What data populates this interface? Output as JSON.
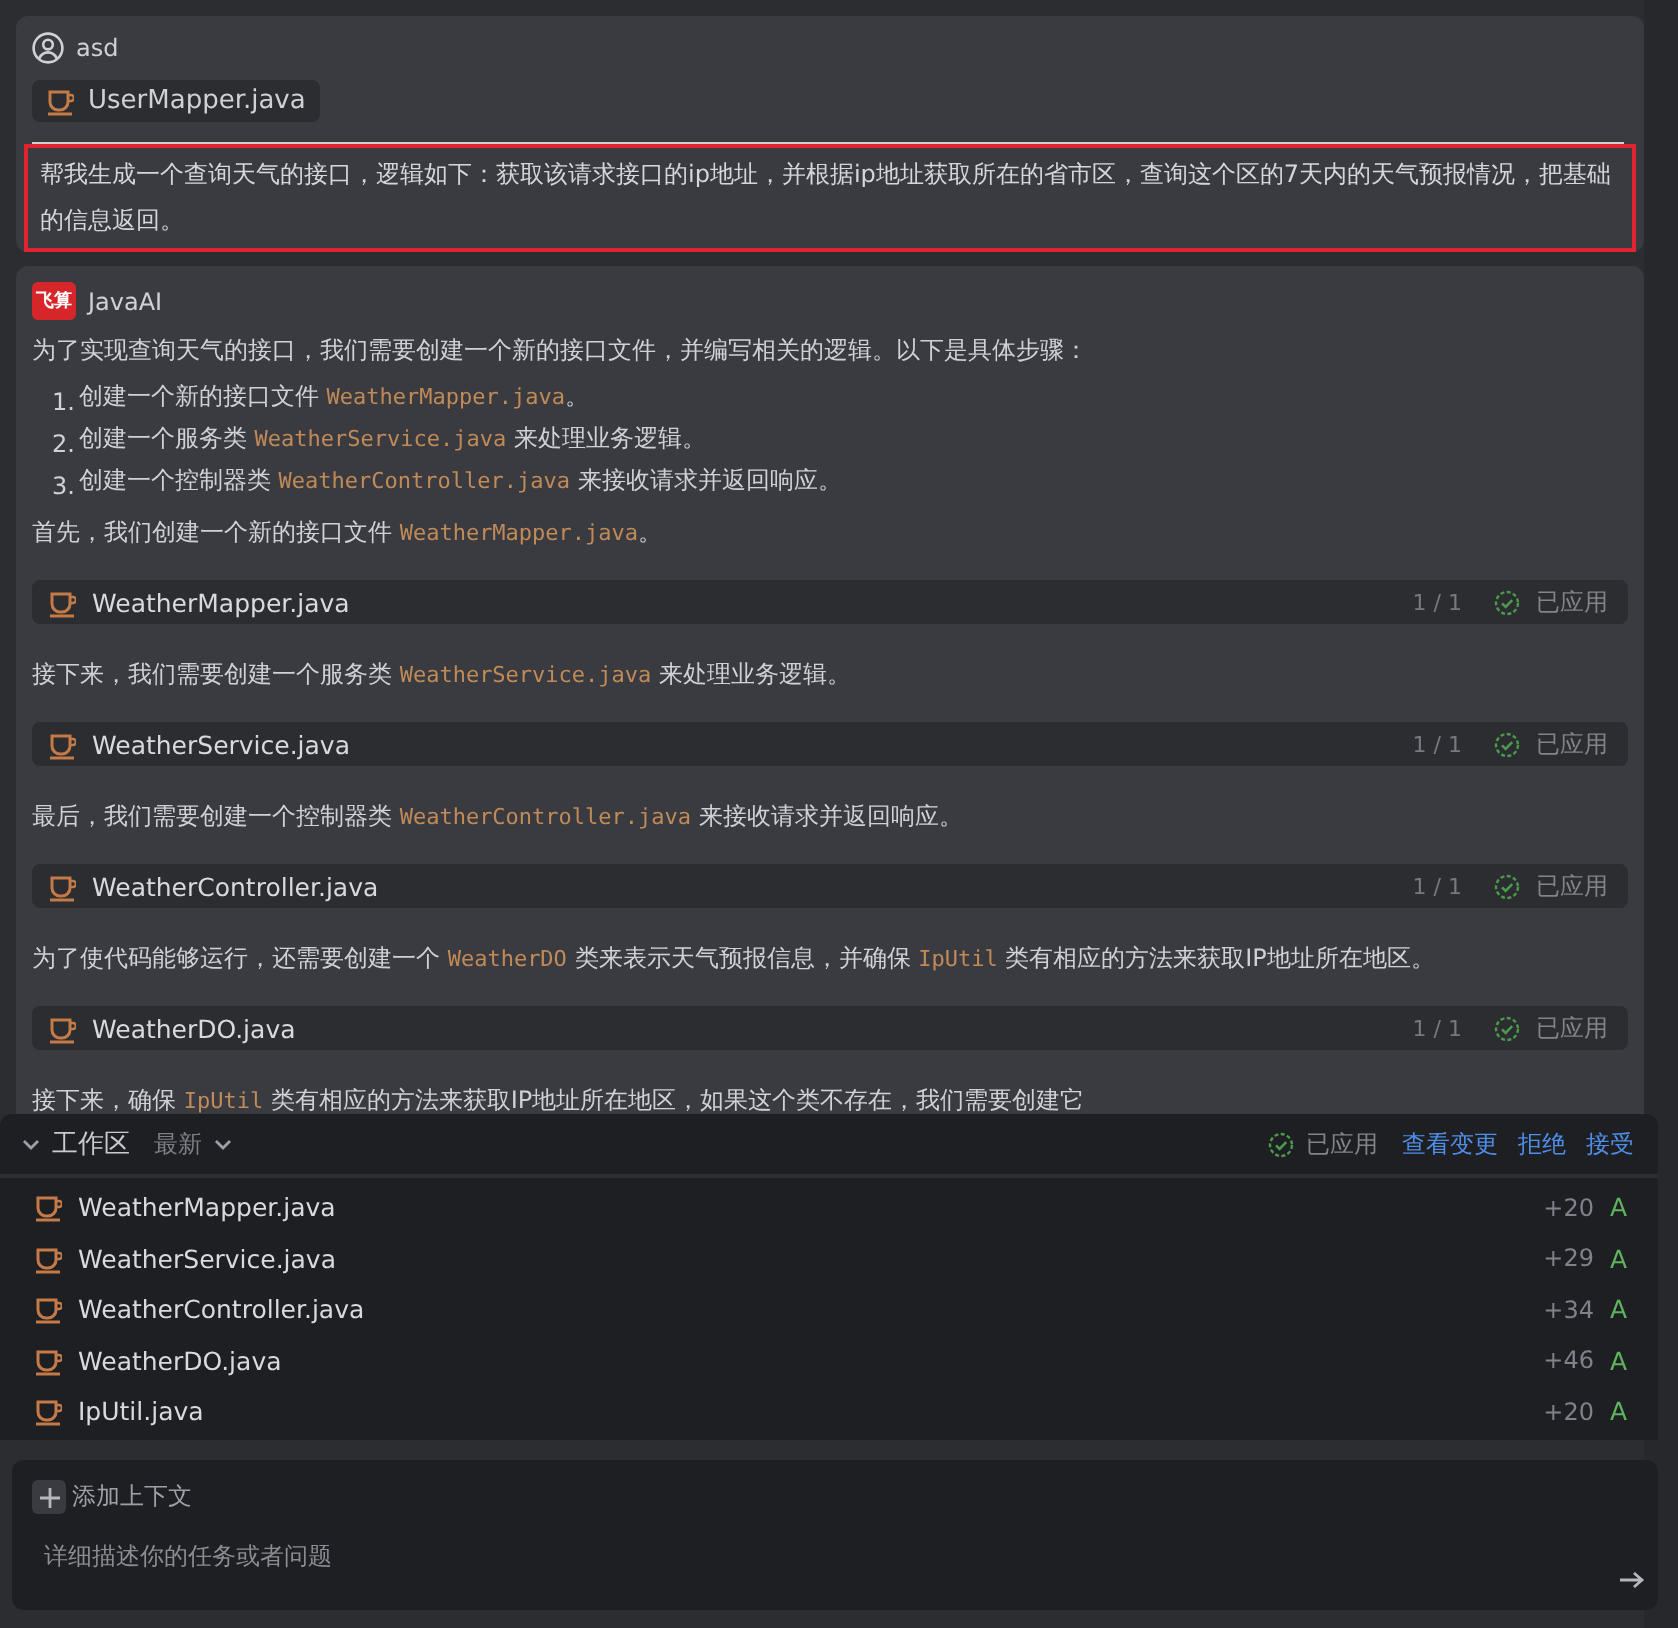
{
  "user": {
    "name": "asd",
    "attachment": "UserMapper.java",
    "message": "帮我生成一个查询天气的接口，逻辑如下：获取该请求接口的ip地址，并根据ip地址获取所在的省市区，查询这个区的7天内的天气预报情况，把基础的信息返回。",
    "highlighted": true
  },
  "assistant": {
    "name": "JavaAI",
    "logo": "飞算",
    "blocks": [
      {
        "kind": "paragraph",
        "parts": [
          {
            "kind": "text",
            "text": "为了实现查询天气的接口，我们需要创建一个新的接口文件，并编写相关的逻辑。以下是具体步骤："
          }
        ]
      },
      {
        "kind": "list",
        "items": [
          {
            "number": "1.",
            "parts": [
              {
                "kind": "text",
                "text": "创建一个新的接口文件 "
              },
              {
                "kind": "code",
                "text": "WeatherMapper.java"
              },
              {
                "kind": "text",
                "text": "。"
              }
            ]
          },
          {
            "number": "2.",
            "parts": [
              {
                "kind": "text",
                "text": "创建一个服务类 "
              },
              {
                "kind": "code",
                "text": "WeatherService.java"
              },
              {
                "kind": "text",
                "text": " 来处理业务逻辑。"
              }
            ]
          },
          {
            "number": "3.",
            "parts": [
              {
                "kind": "text",
                "text": "创建一个控制器类 "
              },
              {
                "kind": "code",
                "text": "WeatherController.java"
              },
              {
                "kind": "text",
                "text": " 来接收请求并返回响应。"
              }
            ]
          }
        ]
      },
      {
        "kind": "paragraph",
        "parts": [
          {
            "kind": "text",
            "text": "首先，我们创建一个新的接口文件 "
          },
          {
            "kind": "code",
            "text": "WeatherMapper.java"
          },
          {
            "kind": "text",
            "text": "。"
          }
        ]
      },
      {
        "kind": "file",
        "name": "WeatherMapper.java",
        "count": "1 / 1",
        "status": "已应用"
      },
      {
        "kind": "paragraph",
        "parts": [
          {
            "kind": "text",
            "text": "接下来，我们需要创建一个服务类 "
          },
          {
            "kind": "code",
            "text": "WeatherService.java"
          },
          {
            "kind": "text",
            "text": " 来处理业务逻辑。"
          }
        ]
      },
      {
        "kind": "file",
        "name": "WeatherService.java",
        "count": "1 / 1",
        "status": "已应用"
      },
      {
        "kind": "paragraph",
        "parts": [
          {
            "kind": "text",
            "text": "最后，我们需要创建一个控制器类 "
          },
          {
            "kind": "code",
            "text": "WeatherController.java"
          },
          {
            "kind": "text",
            "text": " 来接收请求并返回响应。"
          }
        ]
      },
      {
        "kind": "file",
        "name": "WeatherController.java",
        "count": "1 / 1",
        "status": "已应用"
      },
      {
        "kind": "paragraph",
        "parts": [
          {
            "kind": "text",
            "text": "为了使代码能够运行，还需要创建一个 "
          },
          {
            "kind": "code",
            "text": "WeatherDO"
          },
          {
            "kind": "text",
            "text": " 类来表示天气预报信息，并确保 "
          },
          {
            "kind": "code",
            "text": "IpUtil"
          },
          {
            "kind": "text",
            "text": " 类有相应的方法来获取IP地址所在地区。"
          }
        ]
      },
      {
        "kind": "file",
        "name": "WeatherDO.java",
        "count": "1 / 1",
        "status": "已应用"
      },
      {
        "kind": "paragraph",
        "parts": [
          {
            "kind": "text",
            "text": "接下来，确保 "
          },
          {
            "kind": "code",
            "text": "IpUtil"
          },
          {
            "kind": "text",
            "text": " 类有相应的方法来获取IP地址所在地区，如果这个类不存在，我们需要创建它"
          }
        ]
      }
    ]
  },
  "workspace": {
    "title": "工作区",
    "expanded": true,
    "filter": "最新",
    "status": "已应用",
    "actions": [
      "查看变更",
      "拒绝",
      "接受"
    ],
    "files": [
      {
        "name": "WeatherMapper.java",
        "added": "+20",
        "change": "A"
      },
      {
        "name": "WeatherService.java",
        "added": "+29",
        "change": "A"
      },
      {
        "name": "WeatherController.java",
        "added": "+34",
        "change": "A"
      },
      {
        "name": "WeatherDO.java",
        "added": "+46",
        "change": "A"
      },
      {
        "name": "IpUtil.java",
        "added": "+20",
        "change": "A"
      }
    ]
  },
  "composer": {
    "add_context": "添加上下文",
    "placeholder": "详细描述你的任务或者问题"
  }
}
